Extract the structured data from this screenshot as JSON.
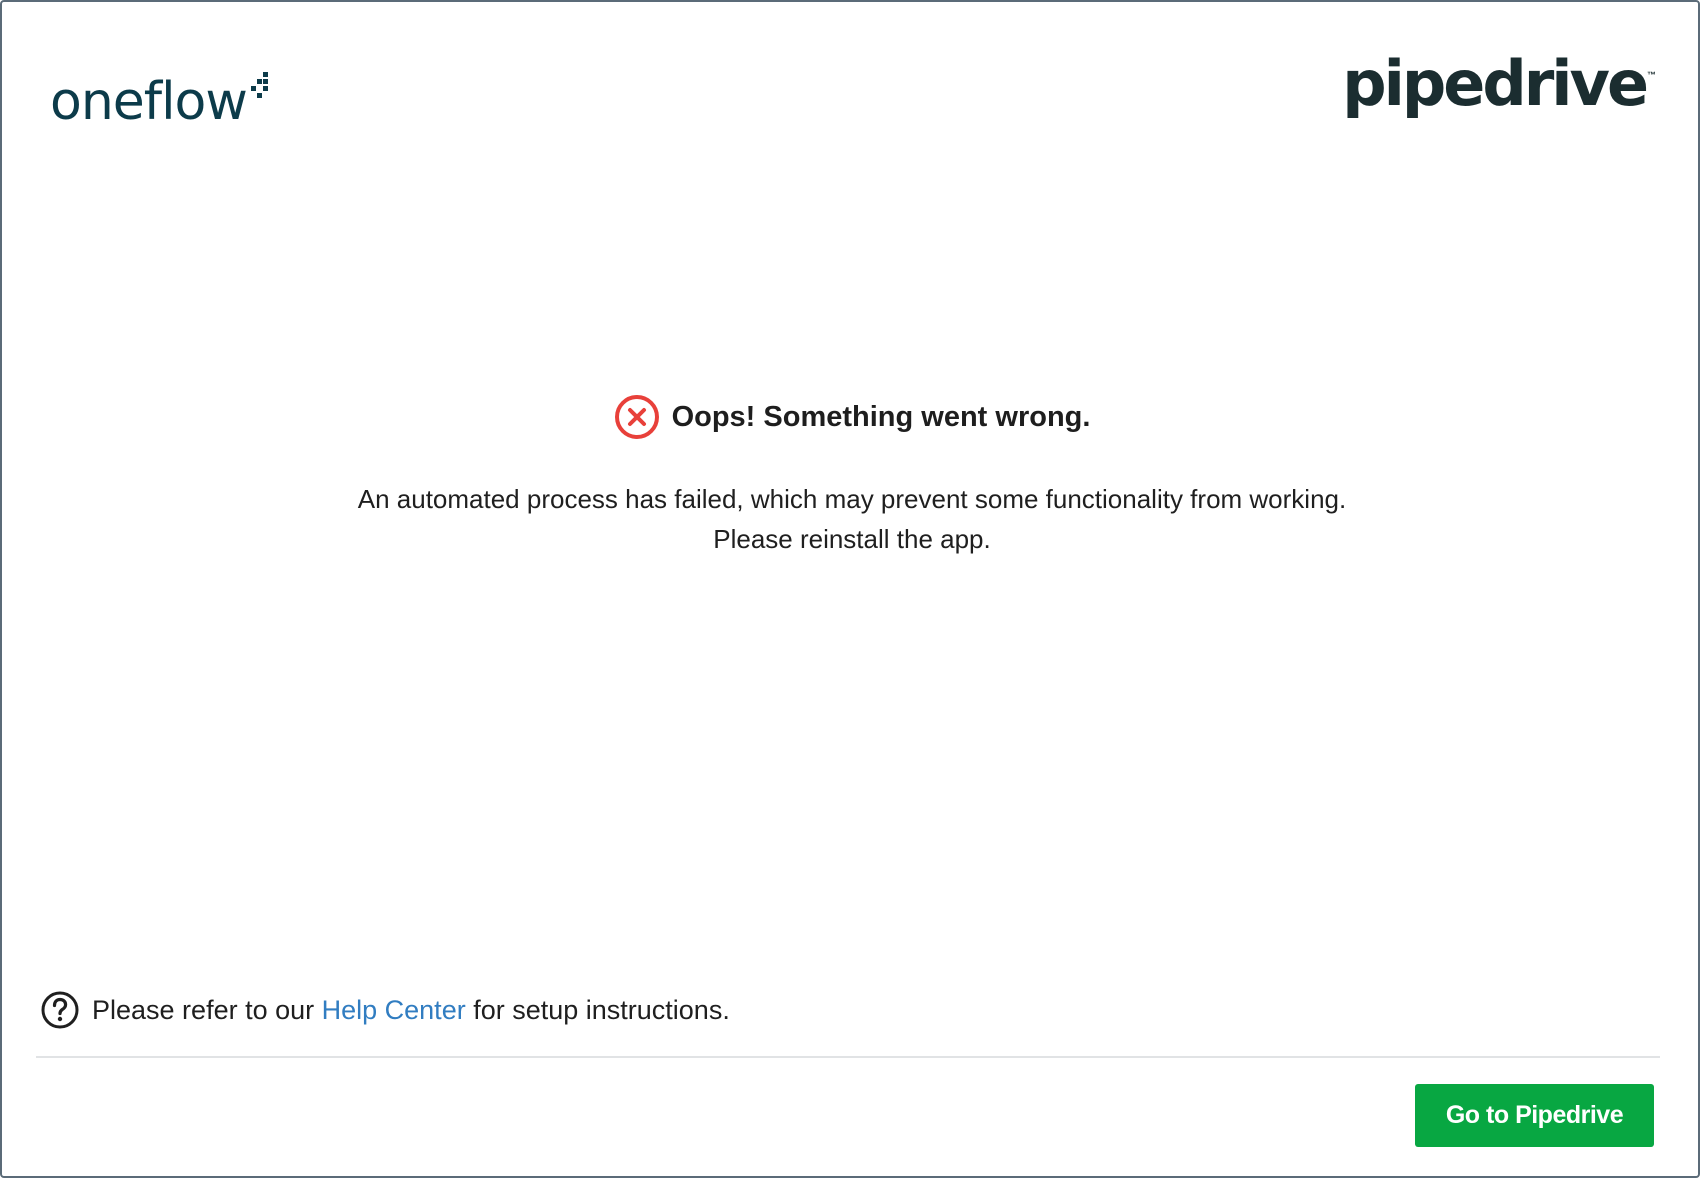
{
  "header": {
    "left_logo_text": "oneflow",
    "right_logo_text": "pipedrive",
    "right_logo_mark": "™",
    "left_logo_icon": "pixel-dots-icon"
  },
  "error": {
    "icon": "error-circle-x-icon",
    "title": "Oops! Something went wrong.",
    "message_line1": "An automated process has failed, which may prevent some functionality from working.",
    "message_line2": "Please reinstall the app."
  },
  "help": {
    "icon": "question-circle-icon",
    "prefix": "Please refer to our ",
    "link_label": "Help Center",
    "suffix": " for setup instructions."
  },
  "footer": {
    "button_label": "Go to Pipedrive"
  },
  "colors": {
    "oneflow_brand": "#0c3b4a",
    "pipedrive_brand": "#1b2d30",
    "error_red": "#e8403a",
    "link_blue": "#317dc1",
    "button_green": "#08a742"
  }
}
